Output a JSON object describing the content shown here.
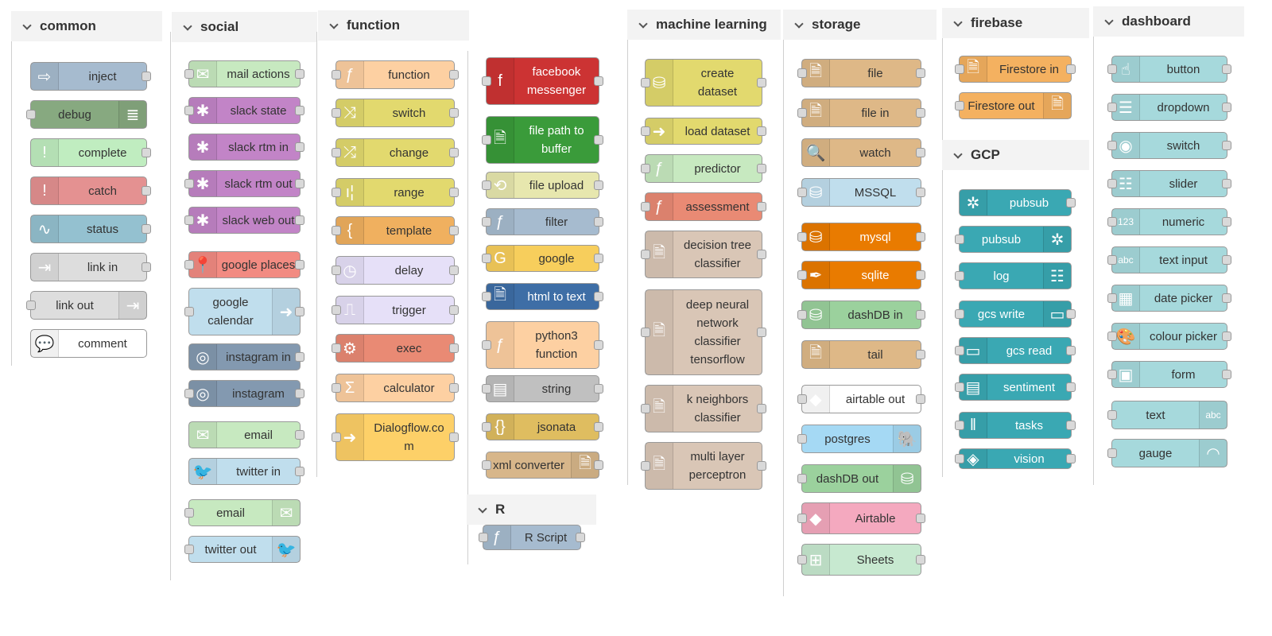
{
  "categories": [
    {
      "id": "common",
      "title": "common",
      "nodes": [
        {
          "label": "inject",
          "color": "#a6bbcf",
          "icon": "inject-icon",
          "glyph": "⇨",
          "in": false,
          "out": true
        },
        {
          "label": "debug",
          "color": "#87a980",
          "icon": "debug-icon",
          "glyph": "≣",
          "in": true,
          "out": false,
          "right": true
        },
        {
          "label": "complete",
          "color": "#c0edc0",
          "icon": "alert-icon",
          "glyph": "!",
          "in": false,
          "out": true
        },
        {
          "label": "catch",
          "color": "#e49191",
          "icon": "alert-icon",
          "glyph": "!",
          "in": false,
          "out": true
        },
        {
          "label": "status",
          "color": "#94c1d0",
          "icon": "status-icon",
          "glyph": "∿",
          "in": false,
          "out": true
        },
        {
          "label": "link in",
          "color": "#dddddd",
          "icon": "link-in-icon",
          "glyph": "⇥",
          "in": false,
          "out": true
        },
        {
          "label": "link out",
          "color": "#dddddd",
          "icon": "link-out-icon",
          "glyph": "⇥",
          "in": true,
          "out": false,
          "right": true
        },
        {
          "label": "comment",
          "color": "#ffffff",
          "icon": "comment-icon",
          "glyph": "💬",
          "in": false,
          "out": false
        }
      ]
    },
    {
      "id": "social",
      "title": "social",
      "nodes": [
        {
          "label": "mail actions",
          "color": "#c7e9c0",
          "icon": "envelope-icon",
          "glyph": "✉",
          "in": true,
          "out": true
        },
        {
          "label": "slack state",
          "color": "#c284c7",
          "icon": "slack-icon",
          "glyph": "✱",
          "in": true,
          "out": true
        },
        {
          "label": "slack rtm in",
          "color": "#c284c7",
          "icon": "slack-icon",
          "glyph": "✱",
          "in": false,
          "out": true
        },
        {
          "label": "slack rtm out",
          "color": "#c284c7",
          "icon": "slack-icon",
          "glyph": "✱",
          "in": true,
          "out": true
        },
        {
          "label": "slack web out",
          "color": "#c284c7",
          "icon": "slack-icon",
          "glyph": "✱",
          "in": true,
          "out": true
        },
        {
          "label": "google places",
          "color": "#f28b82",
          "icon": "map-pin-icon",
          "glyph": "📍",
          "in": true,
          "out": true
        },
        {
          "label": "google\ncalendar",
          "color": "#c0deed",
          "icon": "arrow-right-icon",
          "glyph": "➜",
          "in": true,
          "out": true,
          "right": true
        },
        {
          "label": "instagram in",
          "color": "#8399b0",
          "icon": "instagram-icon",
          "glyph": "◎",
          "in": false,
          "out": true
        },
        {
          "label": "instagram",
          "color": "#8399b0",
          "icon": "instagram-icon",
          "glyph": "◎",
          "in": true,
          "out": true
        },
        {
          "label": "email",
          "color": "#c7e9c0",
          "icon": "envelope-icon",
          "glyph": "✉",
          "in": false,
          "out": true
        },
        {
          "label": "twitter in",
          "color": "#c0deed",
          "icon": "twitter-icon",
          "glyph": "🐦",
          "in": false,
          "out": true
        },
        {
          "label": "email",
          "color": "#c7e9c0",
          "icon": "envelope-icon",
          "glyph": "✉",
          "in": true,
          "out": false,
          "right": true
        },
        {
          "label": "twitter out",
          "color": "#c0deed",
          "icon": "twitter-icon",
          "glyph": "🐦",
          "in": true,
          "out": false,
          "right": true
        }
      ]
    },
    {
      "id": "function",
      "title": "function",
      "nodes": [
        {
          "label": "function",
          "color": "#fdd0a2",
          "icon": "function-icon",
          "glyph": "ƒ",
          "in": true,
          "out": true
        },
        {
          "label": "switch",
          "color": "#e2d96e",
          "icon": "switch-icon",
          "glyph": "⤨",
          "in": true,
          "out": true
        },
        {
          "label": "change",
          "color": "#e2d96e",
          "icon": "shuffle-icon",
          "glyph": "⤮",
          "in": true,
          "out": true
        },
        {
          "label": "range",
          "color": "#e2d96e",
          "icon": "range-icon",
          "glyph": "ı¦",
          "in": true,
          "out": true
        },
        {
          "label": "template",
          "color": "#f0b05f",
          "icon": "template-icon",
          "glyph": "{",
          "in": true,
          "out": true
        },
        {
          "label": "delay",
          "color": "#e6e0f8",
          "icon": "timer-icon",
          "glyph": "◷",
          "in": true,
          "out": true
        },
        {
          "label": "trigger",
          "color": "#e6e0f8",
          "icon": "trigger-icon",
          "glyph": "⎍",
          "in": true,
          "out": true
        },
        {
          "label": "exec",
          "color": "#e98a74",
          "icon": "gear-icon",
          "glyph": "⚙",
          "in": true,
          "out": true
        },
        {
          "label": "calculator",
          "color": "#fdd0a2",
          "icon": "sigma-icon",
          "glyph": "Σ",
          "in": true,
          "out": true
        },
        {
          "label": "Dialogflow.co\nm",
          "color": "#fdd068",
          "icon": "arrow-right-icon",
          "glyph": "➜",
          "in": true,
          "out": true
        }
      ]
    },
    {
      "id": "function2",
      "title": "",
      "nodes": [
        {
          "label": "facebook\nmessenger",
          "color": "#cc3333",
          "icon": "facebook-icon",
          "glyph": "f",
          "in": true,
          "out": true,
          "dark": true
        },
        {
          "label": "file path to\nbuffer",
          "color": "#3a9b3a",
          "icon": "file-icon",
          "glyph": "🗎",
          "in": true,
          "out": true,
          "dark": true
        },
        {
          "label": "file upload",
          "color": "#e7e7ae",
          "icon": "upload-icon",
          "glyph": "⟲",
          "in": true,
          "out": true
        },
        {
          "label": "filter",
          "color": "#a6bbcf",
          "icon": "function-icon",
          "glyph": "ƒ",
          "in": true,
          "out": true
        },
        {
          "label": "google",
          "color": "#f7ce5c",
          "icon": "google-icon",
          "glyph": "G",
          "in": true,
          "out": true
        },
        {
          "label": "html to text",
          "color": "#3e6ea6",
          "icon": "file-icon",
          "glyph": "🗎",
          "in": true,
          "out": true,
          "dark": true
        },
        {
          "label": "python3\nfunction",
          "color": "#fdd0a2",
          "icon": "function-icon",
          "glyph": "ƒ",
          "in": true,
          "out": true
        },
        {
          "label": "string",
          "color": "#c0c0c0",
          "icon": "string-icon",
          "glyph": "▤",
          "in": true,
          "out": true
        },
        {
          "label": "jsonata",
          "color": "#dfbd60",
          "icon": "braces-icon",
          "glyph": "{}",
          "in": true,
          "out": true
        },
        {
          "label": "xml converter",
          "color": "#d7b68a",
          "icon": "file-icon",
          "glyph": "🗎",
          "in": true,
          "out": true,
          "right": true
        }
      ]
    },
    {
      "id": "r",
      "title": "R",
      "nodes": [
        {
          "label": "R Script",
          "color": "#a6bbcf",
          "icon": "function-icon",
          "glyph": "ƒ",
          "in": true,
          "out": true
        }
      ]
    },
    {
      "id": "ml",
      "title": "machine learning",
      "nodes": [
        {
          "label": "create\ndataset",
          "color": "#e2d96e",
          "icon": "database-icon",
          "glyph": "⛁",
          "in": true,
          "out": true
        },
        {
          "label": "load dataset",
          "color": "#e2d96e",
          "icon": "arrow-right-icon",
          "glyph": "➜",
          "in": true,
          "out": true
        },
        {
          "label": "predictor",
          "color": "#c7e9c0",
          "icon": "function-icon",
          "glyph": "ƒ",
          "in": true,
          "out": true
        },
        {
          "label": "assessment",
          "color": "#e98a74",
          "icon": "function-icon",
          "glyph": "ƒ",
          "in": true,
          "out": true
        },
        {
          "label": "decision tree\nclassifier",
          "color": "#d9c6b6",
          "icon": "file-icon",
          "glyph": "🗎",
          "in": true,
          "out": true
        },
        {
          "label": "deep neural\nnetwork\nclassifier\ntensorflow",
          "color": "#d9c6b6",
          "icon": "file-icon",
          "glyph": "🗎",
          "in": true,
          "out": true
        },
        {
          "label": "k neighbors\nclassifier",
          "color": "#d9c6b6",
          "icon": "file-icon",
          "glyph": "🗎",
          "in": true,
          "out": true
        },
        {
          "label": "multi layer\nperceptron",
          "color": "#d9c6b6",
          "icon": "file-icon",
          "glyph": "🗎",
          "in": true,
          "out": true
        }
      ]
    },
    {
      "id": "storage",
      "title": "storage",
      "nodes": [
        {
          "label": "file",
          "color": "#deb887",
          "icon": "file-out-icon",
          "glyph": "🗎",
          "in": true,
          "out": true
        },
        {
          "label": "file in",
          "color": "#deb887",
          "icon": "file-in-icon",
          "glyph": "🗎",
          "in": true,
          "out": true
        },
        {
          "label": "watch",
          "color": "#deb887",
          "icon": "search-icon",
          "glyph": "🔍",
          "in": false,
          "out": true
        },
        {
          "label": "MSSQL",
          "color": "#c0deed",
          "icon": "database-icon",
          "glyph": "⛁",
          "in": true,
          "out": true
        },
        {
          "label": "mysql",
          "color": "#e97b00",
          "icon": "database-icon",
          "glyph": "⛁",
          "in": true,
          "out": true,
          "dark": true
        },
        {
          "label": "sqlite",
          "color": "#e97b00",
          "icon": "feather-icon",
          "glyph": "✒",
          "in": true,
          "out": true,
          "dark": true
        },
        {
          "label": "dashDB in",
          "color": "#9bd19d",
          "icon": "database-icon",
          "glyph": "⛁",
          "in": true,
          "out": true
        },
        {
          "label": "tail",
          "color": "#deb887",
          "icon": "file-icon",
          "glyph": "🗎",
          "in": false,
          "out": true
        },
        {
          "label": "airtable out",
          "color": "#ffffff",
          "icon": "airtable-icon",
          "glyph": "◆",
          "in": true,
          "out": true
        },
        {
          "label": "postgres",
          "color": "#a5d9f4",
          "icon": "elephant-icon",
          "glyph": "🐘",
          "in": true,
          "out": false,
          "right": true
        },
        {
          "label": "dashDB out",
          "color": "#9bd19d",
          "icon": "database-icon",
          "glyph": "⛁",
          "in": true,
          "out": false,
          "right": true
        },
        {
          "label": "Airtable",
          "color": "#f4a9bf",
          "icon": "airtable-icon",
          "glyph": "◆",
          "in": true,
          "out": true
        },
        {
          "label": "Sheets",
          "color": "#c7e9d0",
          "icon": "sheets-icon",
          "glyph": "⊞",
          "in": true,
          "out": true
        }
      ]
    },
    {
      "id": "firebase",
      "title": "firebase",
      "nodes": [
        {
          "label": "Firestore in",
          "color": "#f4b160",
          "icon": "file-icon",
          "glyph": "🗎",
          "in": true,
          "out": true
        },
        {
          "label": "Firestore out",
          "color": "#f4b160",
          "icon": "file-icon",
          "glyph": "🗎",
          "in": true,
          "out": false,
          "right": true
        }
      ]
    },
    {
      "id": "gcp",
      "title": "GCP",
      "nodes": [
        {
          "label": "pubsub",
          "color": "#3aa8b3",
          "icon": "pubsub-icon",
          "glyph": "✲",
          "in": false,
          "out": true,
          "dark": true
        },
        {
          "label": "pubsub",
          "color": "#3aa8b3",
          "icon": "pubsub-icon",
          "glyph": "✲",
          "in": true,
          "out": false,
          "right": true,
          "dark": true
        },
        {
          "label": "log",
          "color": "#3aa8b3",
          "icon": "log-icon",
          "glyph": "☷",
          "in": true,
          "out": false,
          "right": true,
          "dark": true
        },
        {
          "label": "gcs write",
          "color": "#3aa8b3",
          "icon": "storage-icon",
          "glyph": "▭",
          "in": true,
          "out": true,
          "right": true,
          "dark": true
        },
        {
          "label": "gcs read",
          "color": "#3aa8b3",
          "icon": "storage-icon",
          "glyph": "▭",
          "in": true,
          "out": true,
          "dark": true
        },
        {
          "label": "sentiment",
          "color": "#3aa8b3",
          "icon": "sentiment-icon",
          "glyph": "▤",
          "in": true,
          "out": true,
          "dark": true
        },
        {
          "label": "tasks",
          "color": "#3aa8b3",
          "icon": "tasks-icon",
          "glyph": "‖",
          "in": true,
          "out": true,
          "dark": true
        },
        {
          "label": "vision",
          "color": "#3aa8b3",
          "icon": "vision-icon",
          "glyph": "◈",
          "in": true,
          "out": true,
          "dark": true
        }
      ]
    },
    {
      "id": "dashboard",
      "title": "dashboard",
      "nodes": [
        {
          "label": "button",
          "color": "#a6d9dc",
          "icon": "hand-pointer-icon",
          "glyph": "☝",
          "in": true,
          "out": true
        },
        {
          "label": "dropdown",
          "color": "#a6d9dc",
          "icon": "list-icon",
          "glyph": "☰",
          "in": true,
          "out": true
        },
        {
          "label": "switch",
          "color": "#a6d9dc",
          "icon": "toggle-icon",
          "glyph": "◉",
          "in": true,
          "out": true
        },
        {
          "label": "slider",
          "color": "#a6d9dc",
          "icon": "sliders-icon",
          "glyph": "☷",
          "in": true,
          "out": true
        },
        {
          "label": "numeric",
          "color": "#a6d9dc",
          "icon": "numeric-icon",
          "glyph": "123",
          "in": true,
          "out": true
        },
        {
          "label": "text input",
          "color": "#a6d9dc",
          "icon": "text-input-icon",
          "glyph": "abc",
          "in": true,
          "out": true
        },
        {
          "label": "date picker",
          "color": "#a6d9dc",
          "icon": "calendar-icon",
          "glyph": "▦",
          "in": true,
          "out": true
        },
        {
          "label": "colour picker",
          "color": "#a6d9dc",
          "icon": "palette-icon",
          "glyph": "🎨",
          "in": true,
          "out": true
        },
        {
          "label": "form",
          "color": "#a6d9dc",
          "icon": "form-icon",
          "glyph": "▣",
          "in": true,
          "out": true
        },
        {
          "label": "text",
          "color": "#a6d9dc",
          "icon": "text-icon",
          "glyph": "abc",
          "in": true,
          "out": false,
          "right": true
        },
        {
          "label": "gauge",
          "color": "#a6d9dc",
          "icon": "gauge-icon",
          "glyph": "◠",
          "in": true,
          "out": false,
          "right": true
        }
      ]
    }
  ]
}
